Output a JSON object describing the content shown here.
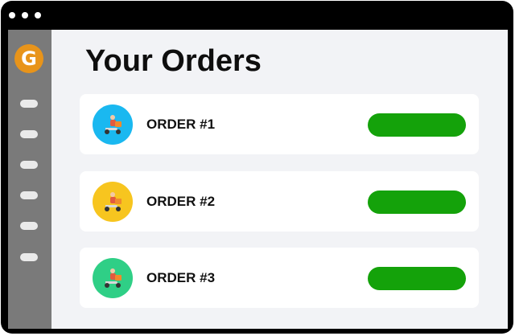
{
  "window": {
    "titlebar_dots": 3
  },
  "sidebar": {
    "logo_letter": "G",
    "logo_color": "#e8941a",
    "nav_items": 6
  },
  "main": {
    "title": "Your Orders",
    "orders": [
      {
        "label": "ORDER #1",
        "avatar_color": "#1ab8f0",
        "icon": "delivery-scooter-icon",
        "status_color": "#14a20a"
      },
      {
        "label": "ORDER #2",
        "avatar_color": "#f7c51f",
        "icon": "delivery-scooter-icon",
        "status_color": "#14a20a"
      },
      {
        "label": "ORDER #3",
        "avatar_color": "#2fcf86",
        "icon": "delivery-scooter-icon",
        "status_color": "#14a20a"
      }
    ]
  }
}
